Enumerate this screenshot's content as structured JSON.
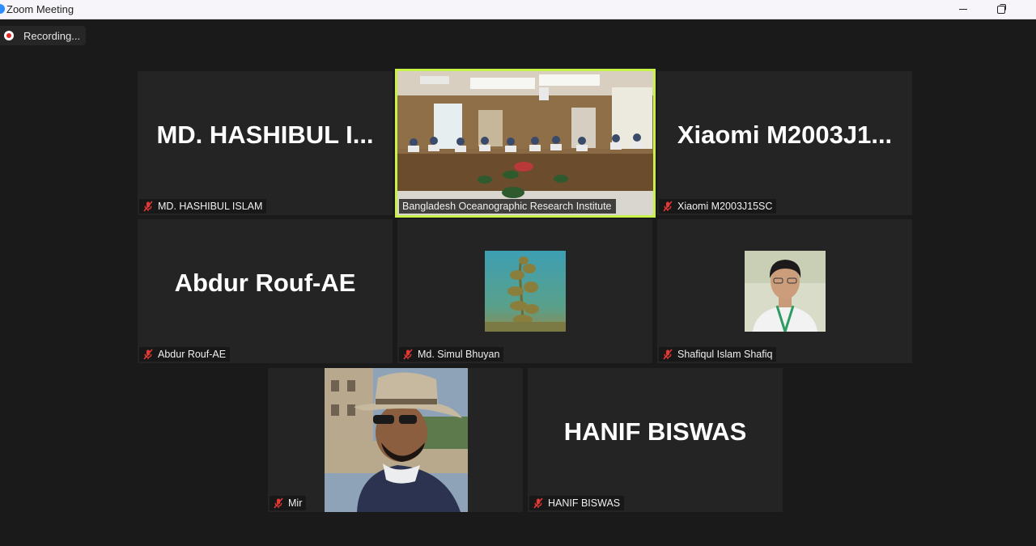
{
  "window": {
    "title": "Zoom Meeting"
  },
  "recording": {
    "label": "Recording..."
  },
  "participants": [
    {
      "display_name": "MD.  HASHIBUL  I...",
      "name_tag": "MD. HASHIBUL ISLAM",
      "muted": true
    },
    {
      "name_tag": "Bangladesh Oceanographic Research Institute",
      "active_speaker": true,
      "video": "conference-room-video"
    },
    {
      "display_name": "Xiaomi  M2003J1...",
      "name_tag": "Xiaomi M2003J15SC",
      "muted": true
    },
    {
      "display_name": "Abdur Rouf-AE",
      "name_tag": "Abdur Rouf-AE",
      "muted": true
    },
    {
      "name_tag": "Md. Simul Bhuyan",
      "muted": true,
      "picture": "seaweed-underwater-photo"
    },
    {
      "name_tag": "Shafiqul Islam Shafiq",
      "muted": true,
      "picture": "profile-photo"
    },
    {
      "name_tag": "Mir",
      "muted": true,
      "picture": "profile-photo-hat-sunglasses"
    },
    {
      "display_name": "HANIF BISWAS",
      "name_tag": "HANIF BISWAS",
      "muted": true
    }
  ],
  "colors": {
    "active_speaker_border": "#c8f24a",
    "muted_icon": "#e53935",
    "tile_bg": "#242424"
  }
}
